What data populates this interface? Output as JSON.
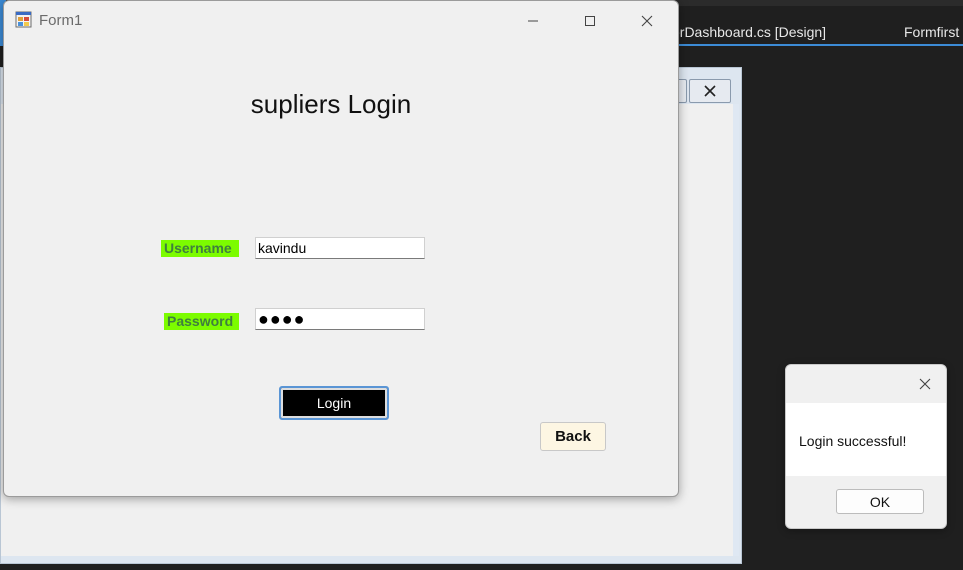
{
  "ide": {
    "tabs": [
      {
        "label": "erDashboard.cs [Design]"
      },
      {
        "label": "Formfirst"
      }
    ],
    "accent": "#3c8bd6"
  },
  "form1": {
    "title": "Form1",
    "icon": "winforms-app-icon",
    "heading": "supliers Login",
    "username_label": "Username",
    "username_value": "kavindu",
    "password_label": "Password",
    "password_value": "●●●●",
    "login_label": "Login",
    "back_label": "Back",
    "label_bg": "#7cfc00"
  },
  "msgbox": {
    "message": "Login successful!",
    "ok_label": "OK"
  }
}
